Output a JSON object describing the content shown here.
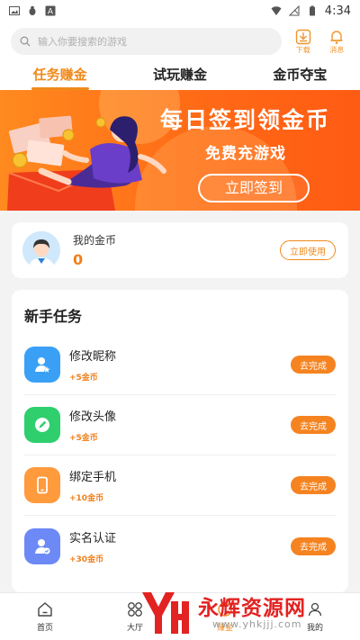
{
  "status_bar": {
    "time": "4:34"
  },
  "header": {
    "search_placeholder": "输入你要搜索的游戏",
    "download_label": "下载",
    "message_label": "消息"
  },
  "tabs": [
    {
      "label": "任务赚金",
      "active": true
    },
    {
      "label": "试玩赚金",
      "active": false
    },
    {
      "label": "金币夺宝",
      "active": false
    }
  ],
  "banner": {
    "title": "每日签到领金币",
    "subtitle": "免费充游戏",
    "button": "立即签到"
  },
  "coins_card": {
    "label": "我的金币",
    "value": "0",
    "button": "立即使用"
  },
  "tasks_card": {
    "title": "新手任务",
    "items": [
      {
        "name": "修改昵称",
        "reward": "+5金币",
        "button": "去完成",
        "icon": "user-star-icon",
        "color": "#3aa0f6"
      },
      {
        "name": "修改头像",
        "reward": "+5金币",
        "button": "去完成",
        "icon": "pencil-icon",
        "color": "#2fcf6d"
      },
      {
        "name": "绑定手机",
        "reward": "+10金币",
        "button": "去完成",
        "icon": "phone-icon",
        "color": "#ff9a3d"
      },
      {
        "name": "实名认证",
        "reward": "+30金币",
        "button": "去完成",
        "icon": "id-verify-icon",
        "color": "#6c89f5"
      }
    ]
  },
  "bottom_nav": [
    {
      "label": "首页",
      "icon": "home-icon"
    },
    {
      "label": "大厅",
      "icon": "grid-icon"
    },
    {
      "label": "赚金",
      "icon": "coin-icon"
    },
    {
      "label": "我的",
      "icon": "user-icon"
    }
  ],
  "watermark": {
    "text": "永辉资源网",
    "url": "www.yhkjjj.com"
  },
  "colors": {
    "accent": "#f08a1c",
    "button": "#f58320"
  }
}
